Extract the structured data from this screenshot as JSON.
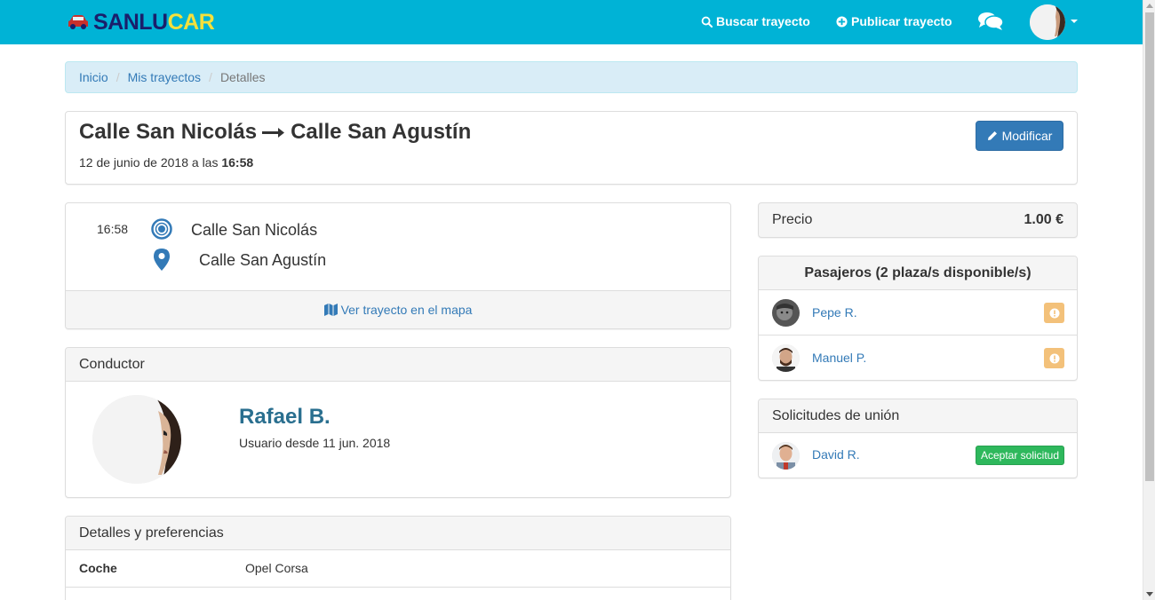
{
  "brand": {
    "part1": "SANLU",
    "part2": "CAR"
  },
  "navbar": {
    "search_label": "Buscar trayecto",
    "publish_label": "Publicar trayecto"
  },
  "breadcrumb": {
    "home": "Inicio",
    "trips": "Mis trayectos",
    "current": "Detalles"
  },
  "trip": {
    "origin": "Calle San Nicolás",
    "destination": "Calle San Agustín",
    "date_prefix": "12 de junio de 2018 a las ",
    "time": "16:58",
    "modify_label": "Modificar",
    "map_link": "Ver trayecto en el mapa"
  },
  "driver": {
    "heading": "Conductor",
    "name": "Rafael B.",
    "since": "Usuario desde 11 jun. 2018"
  },
  "details": {
    "heading": "Detalles y preferencias",
    "rows": [
      {
        "key": "Coche",
        "value": "Opel Corsa"
      }
    ]
  },
  "price": {
    "label": "Precio",
    "value": "1.00 €"
  },
  "passengers": {
    "heading": "Pasajeros (2 plaza/s disponible/s)",
    "list": [
      {
        "name": "Pepe R."
      },
      {
        "name": "Manuel P."
      }
    ]
  },
  "requests": {
    "heading": "Solicitudes de unión",
    "list": [
      {
        "name": "David R.",
        "action": "Aceptar solicitud"
      }
    ]
  },
  "colors": {
    "navbar": "#00b3d6",
    "primary": "#337ab7",
    "success": "#2eb85c",
    "warning": "#f0ad4e",
    "breadcrumb_bg": "#d9edf7"
  },
  "icons": {
    "brand": "car-icon",
    "search": "search-icon",
    "publish": "plus-circle-icon",
    "chat": "comments-icon",
    "edit": "pencil-icon",
    "arrow": "long-arrow-right-icon",
    "origin": "dot-circle-icon",
    "destination": "map-marker-icon",
    "map": "map-icon",
    "warning": "exclamation-circle-icon"
  }
}
